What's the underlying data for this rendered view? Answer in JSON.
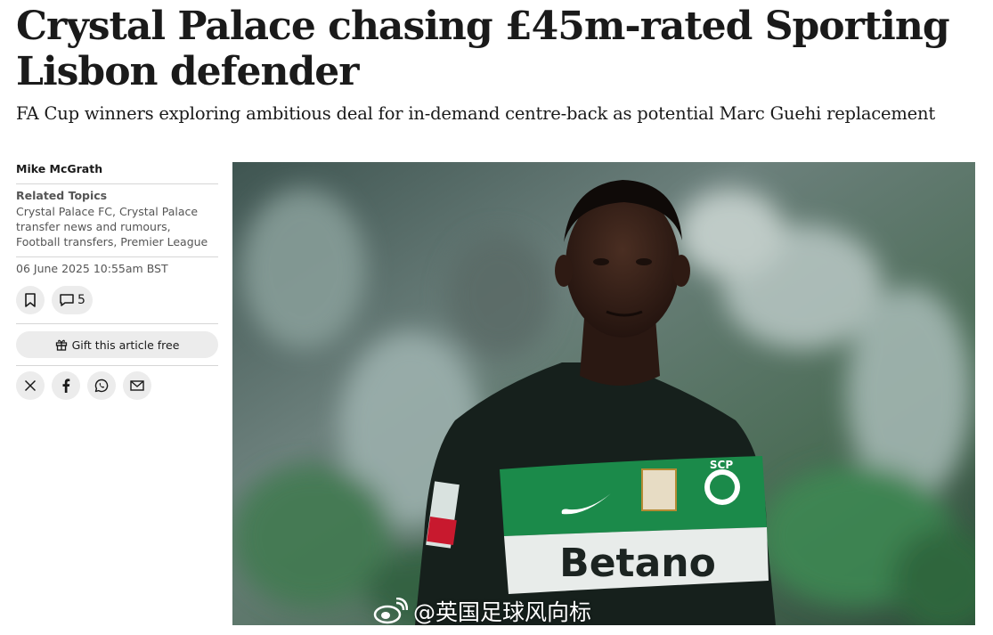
{
  "article": {
    "headline": "Crystal Palace chasing £45m-rated Sporting Lisbon defender",
    "standfirst": "FA Cup winners exploring ambitious deal for in-demand centre-back as potential Marc Guehi replacement"
  },
  "sidebar": {
    "author": "Mike McGrath",
    "related_label": "Related Topics",
    "related_topics": "Crystal Palace FC, Crystal Palace transfer news and rumours, Football transfers, Premier League",
    "date": "06 June 2025 10:55am BST",
    "comment_count": "5",
    "gift_label": "Gift this article free"
  },
  "photo": {
    "jersey_sponsor": "Betano",
    "jersey_badge": "SCP"
  },
  "watermark": {
    "text": "@英国足球风向标"
  },
  "icons": {
    "bookmark": "bookmark-icon",
    "comment": "comment-icon",
    "gift": "gift-icon",
    "x": "x-icon",
    "facebook": "facebook-icon",
    "whatsapp": "whatsapp-icon",
    "email": "email-icon",
    "weibo": "weibo-icon"
  },
  "colors": {
    "jersey_green": "#1b8a4a",
    "jersey_dark": "#16201c",
    "button_bg": "#ececec"
  }
}
